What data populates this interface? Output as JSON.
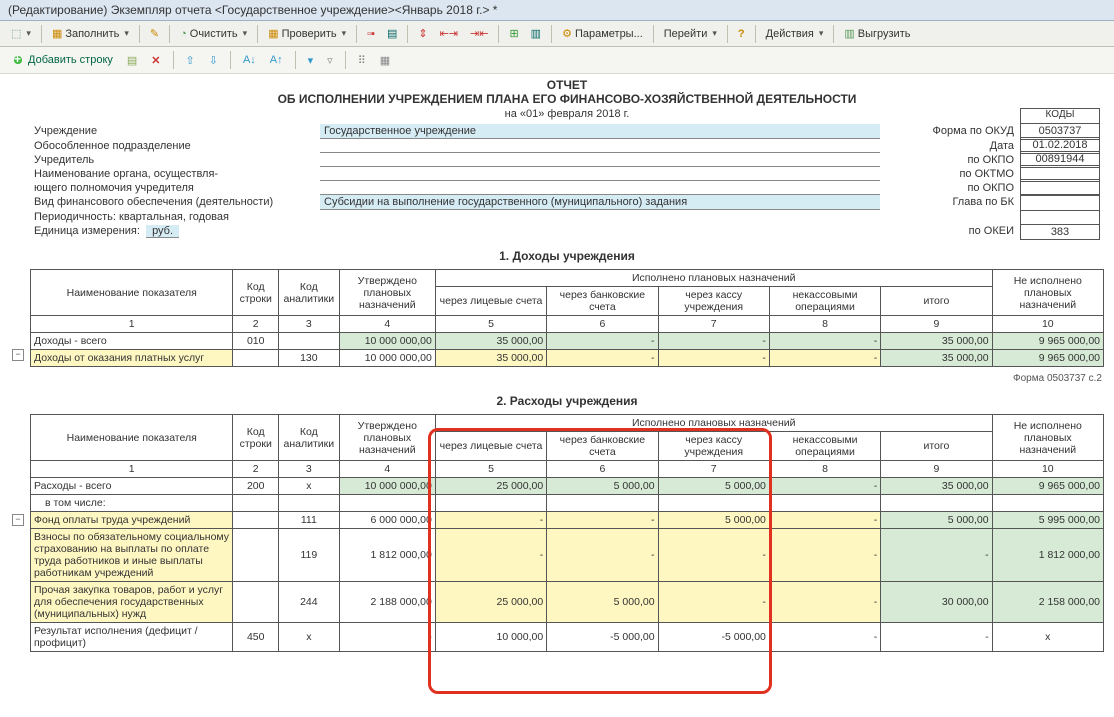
{
  "title_bar": "(Редактирование) Экземпляр отчета <Государственное учреждение><Январь 2018 г.> *",
  "toolbar1": {
    "fill": "Заполнить",
    "clear": "Очистить",
    "check": "Проверить",
    "params": "Параметры...",
    "goto": "Перейти",
    "actions": "Действия",
    "unload": "Выгрузить"
  },
  "toolbar2": {
    "add_row": "Добавить строку"
  },
  "report": {
    "title": "ОТЧЕТ",
    "subtitle": "ОБ ИСПОЛНЕНИИ УЧРЕЖДЕНИЕМ ПЛАНА ЕГО ФИНАНСОВО-ХОЗЯЙСТВЕННОЙ ДЕЯТЕЛЬНОСТИ",
    "date_line": "на «01» февраля 2018 г."
  },
  "hdr": {
    "org_lbl": "Учреждение",
    "org_val": "Государственное учреждение",
    "sep_lbl": "Обособленное подразделение",
    "founder_lbl": "Учредитель",
    "auth1_lbl": "Наименование органа, осуществля-",
    "auth2_lbl": "ющего полномочия учредителя",
    "fin_lbl": "Вид финансового обеспечения (деятельности)",
    "fin_val": "Субсидии на выполнение государственного (муниципального) задания",
    "period_lbl": "Периодичность:  квартальная, годовая",
    "unit_lbl": "Единица измерения:",
    "unit_val": "руб."
  },
  "codes": {
    "head": "КОДЫ",
    "okud_lbl": "Форма по ОКУД",
    "okud": "0503737",
    "date_lbl": "Дата",
    "date": "01.02.2018",
    "okpo_lbl": "по ОКПО",
    "okpo": "00891944",
    "oktmo_lbl": "по ОКТМО",
    "okpo2_lbl": "по ОКПО",
    "bk_lbl": "Глава по БК",
    "okei_lbl": "по ОКЕИ",
    "okei": "383"
  },
  "sec1": {
    "title": "1. Доходы учреждения",
    "cols": {
      "c1": "Наименование показателя",
      "c2": "Код строки",
      "c3": "Код аналитики",
      "c4": "Утверждено плановых назначений",
      "grp": "Исполнено плановых назначений",
      "c5": "через лицевые счета",
      "c6": "через банковские счета",
      "c7": "через кассу учреждения",
      "c8": "некассовыми операциями",
      "c9": "итого",
      "c10": "Не исполнено плановых назначений"
    },
    "nums": {
      "n1": "1",
      "n2": "2",
      "n3": "3",
      "n4": "4",
      "n5": "5",
      "n6": "6",
      "n7": "7",
      "n8": "8",
      "n9": "9",
      "n10": "10"
    },
    "rows": [
      {
        "name": "Доходы - всего",
        "code": "010",
        "an": "",
        "c4": "10 000 000,00",
        "c5": "35 000,00",
        "c6": "-",
        "c7": "-",
        "c8": "-",
        "c9": "35 000,00",
        "c10": "9 965 000,00",
        "cls": "green"
      },
      {
        "name": "Доходы от оказания платных услуг",
        "code": "",
        "an": "130",
        "c4": "10 000 000,00",
        "c5": "35 000,00",
        "c6": "-",
        "c7": "-",
        "c8": "-",
        "c9": "35 000,00",
        "c10": "9 965 000,00",
        "cls": "yellow"
      }
    ]
  },
  "form_note": "Форма 0503737  с.2",
  "sec2": {
    "title": "2. Расходы учреждения",
    "rows": [
      {
        "name": "Расходы - всего",
        "code": "200",
        "an": "х",
        "c4": "10 000 000,00",
        "c5": "25 000,00",
        "c6": "5 000,00",
        "c7": "5 000,00",
        "c8": "-",
        "c9": "35 000,00",
        "c10": "9 965 000,00",
        "cls": "green"
      },
      {
        "name": "в том числе:",
        "code": "",
        "an": "",
        "c4": "",
        "c5": "",
        "c6": "",
        "c7": "",
        "c8": "",
        "c9": "",
        "c10": "",
        "cls": "white",
        "indent": true
      },
      {
        "name": "Фонд оплаты труда учреждений",
        "code": "",
        "an": "111",
        "c4": "6 000 000,00",
        "c5": "-",
        "c6": "-",
        "c7": "5 000,00",
        "c8": "-",
        "c9": "5 000,00",
        "c10": "5 995 000,00",
        "cls": "yellow"
      },
      {
        "name": "Взносы по обязательному социальному страхованию на выплаты по оплате труда работников и иные выплаты работникам учреждений",
        "code": "",
        "an": "119",
        "c4": "1 812 000,00",
        "c5": "-",
        "c6": "-",
        "c7": "-",
        "c8": "-",
        "c9": "-",
        "c10": "1 812 000,00",
        "cls": "yellow"
      },
      {
        "name": "Прочая закупка товаров, работ и услуг для обеспечения государственных (муниципальных) нужд",
        "code": "",
        "an": "244",
        "c4": "2 188 000,00",
        "c5": "25 000,00",
        "c6": "5 000,00",
        "c7": "-",
        "c8": "-",
        "c9": "30 000,00",
        "c10": "2 158 000,00",
        "cls": "yellow"
      },
      {
        "name": "Результат исполнения  (дефицит / профицит)",
        "code": "450",
        "an": "х",
        "c4": "-",
        "c5": "10 000,00",
        "c6": "-5 000,00",
        "c7": "-5 000,00",
        "c8": "-",
        "c9": "-",
        "c10": "х",
        "cls": "white"
      }
    ]
  }
}
